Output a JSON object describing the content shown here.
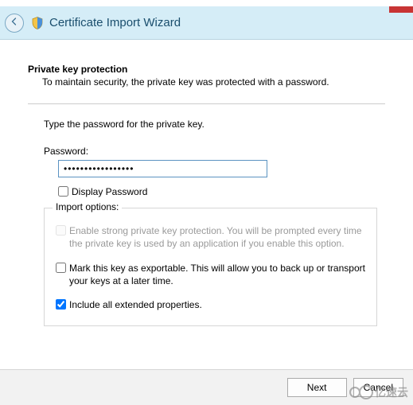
{
  "header": {
    "title": "Certificate Import Wizard"
  },
  "section": {
    "title": "Private key protection",
    "description": "To maintain security, the private key was protected with a password."
  },
  "instruction": "Type the password for the private key.",
  "password": {
    "label": "Password:",
    "value": "•••••••••••••••••",
    "display_label": "Display Password",
    "display_checked": false
  },
  "options": {
    "legend": "Import options:",
    "items": [
      {
        "label": "Enable strong private key protection. You will be prompted every time the private key is used by an application if you enable this option.",
        "checked": false,
        "disabled": true
      },
      {
        "label": "Mark this key as exportable. This will allow you to back up or transport your keys at a later time.",
        "checked": false,
        "disabled": false
      },
      {
        "label": "Include all extended properties.",
        "checked": true,
        "disabled": false
      }
    ]
  },
  "footer": {
    "next": "Next",
    "cancel": "Cancel"
  },
  "watermark": "亿速云"
}
